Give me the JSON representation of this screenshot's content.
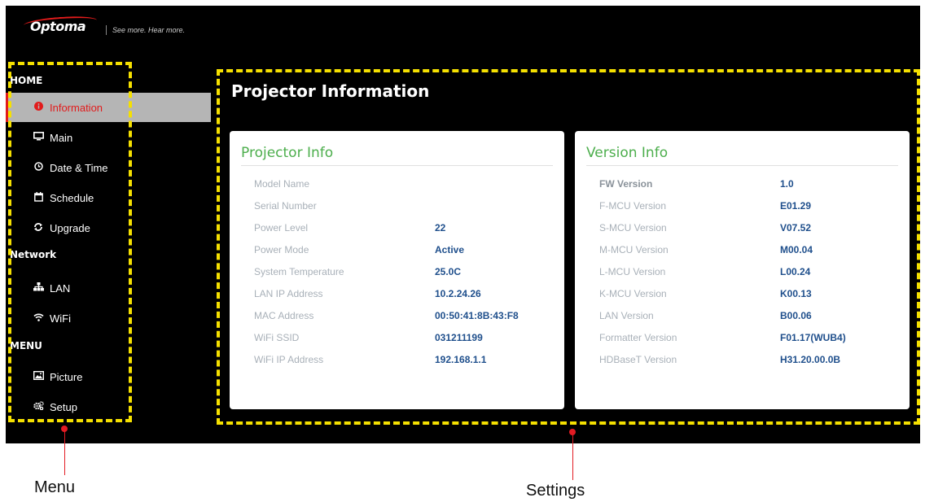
{
  "header": {
    "logo_text": "Optoma",
    "tagline": "See more. Hear more."
  },
  "sidebar": {
    "sections": [
      {
        "title": "HOME",
        "items": [
          {
            "label": "Information",
            "icon": "info-circle-icon",
            "active": true
          },
          {
            "label": "Main",
            "icon": "monitor-icon"
          },
          {
            "label": "Date & Time",
            "icon": "clock-icon"
          },
          {
            "label": "Schedule",
            "icon": "calendar-icon"
          },
          {
            "label": "Upgrade",
            "icon": "refresh-icon"
          }
        ]
      },
      {
        "title": "Network",
        "items": [
          {
            "label": "LAN",
            "icon": "network-icon"
          },
          {
            "label": "WiFi",
            "icon": "wifi-icon"
          }
        ]
      },
      {
        "title": "MENU",
        "items": [
          {
            "label": "Picture",
            "icon": "picture-icon"
          },
          {
            "label": "Setup",
            "icon": "cogs-icon"
          }
        ]
      }
    ]
  },
  "main": {
    "title": "Projector Information",
    "projector_info": {
      "title": "Projector Info",
      "rows": [
        {
          "label": "Model Name",
          "value": ""
        },
        {
          "label": "Serial Number",
          "value": ""
        },
        {
          "label": "Power Level",
          "value": "22"
        },
        {
          "label": "Power Mode",
          "value": "Active"
        },
        {
          "label": "System Temperature",
          "value": "25.0C"
        },
        {
          "label": "LAN IP Address",
          "value": "10.2.24.26"
        },
        {
          "label": "MAC Address",
          "value": "00:50:41:8B:43:F8"
        },
        {
          "label": "WiFi SSID",
          "value": "031211199"
        },
        {
          "label": "WiFi IP Address",
          "value": "192.168.1.1"
        }
      ]
    },
    "version_info": {
      "title": "Version Info",
      "rows": [
        {
          "label": "FW Version",
          "value": "1.0"
        },
        {
          "label": "F-MCU Version",
          "value": "E01.29"
        },
        {
          "label": "S-MCU Version",
          "value": "V07.52"
        },
        {
          "label": "M-MCU Version",
          "value": "M00.04"
        },
        {
          "label": "L-MCU Version",
          "value": "L00.24"
        },
        {
          "label": "K-MCU Version",
          "value": "K00.13"
        },
        {
          "label": "LAN Version",
          "value": "B00.06"
        },
        {
          "label": "Formatter Version",
          "value": "F01.17(WUB4)"
        },
        {
          "label": "HDBaseT Version",
          "value": "H31.20.00.0B"
        }
      ]
    }
  },
  "callouts": {
    "menu": "Menu",
    "settings": "Settings"
  },
  "colors": {
    "accent_red": "#e21b1b",
    "card_title_green": "#4cae4c",
    "value_blue": "#1f4f8c",
    "highlight_yellow": "#f5e000"
  }
}
